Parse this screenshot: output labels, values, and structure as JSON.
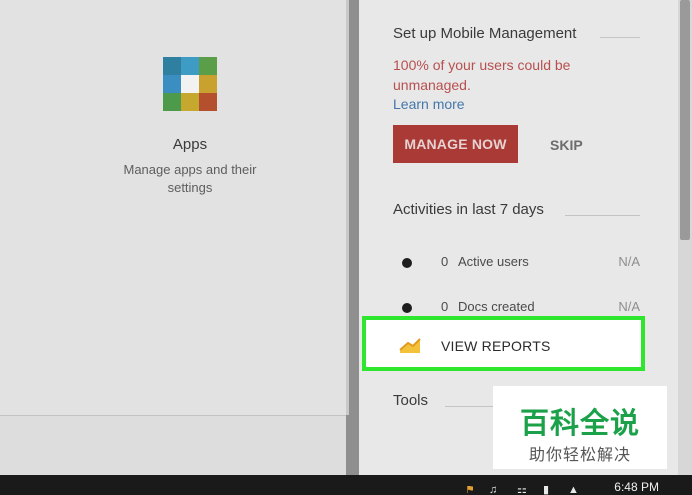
{
  "apps_card": {
    "title": "Apps",
    "description": "Manage apps and their settings",
    "icon": "apps-grid-icon"
  },
  "mobile_management": {
    "title": "Set up Mobile Management",
    "warning": "100% of your users could be unmanaged.",
    "learn_more": "Learn more",
    "manage_now": "MANAGE NOW",
    "skip": "SKIP"
  },
  "activities": {
    "title": "Activities in last 7 days",
    "rows": [
      {
        "count": "0",
        "label": "Active users",
        "status": "N/A"
      },
      {
        "count": "0",
        "label": "Docs created",
        "status": "N/A"
      }
    ]
  },
  "view_reports": {
    "label": "VIEW REPORTS",
    "icon": "chart-trend-icon"
  },
  "tools": {
    "title": "Tools"
  },
  "taskbar": {
    "time": "6:48 PM"
  },
  "watermark": {
    "main": "百科全说",
    "sub": "助你轻松解决"
  },
  "colors": {
    "manage_button": "#a93a36",
    "warning_text": "#b84f4f",
    "link": "#4477aa",
    "highlight_border": "#2ee62e",
    "watermark_text": "#1aa14a"
  }
}
